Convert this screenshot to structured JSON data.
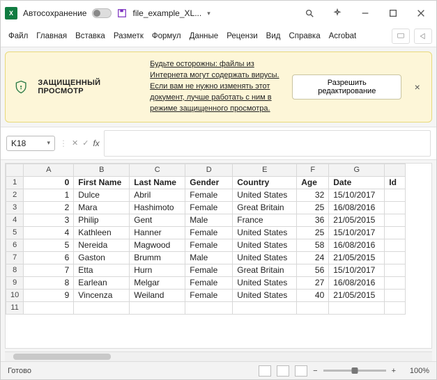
{
  "titlebar": {
    "autosave": "Автосохранение",
    "filename": "file_example_XL..."
  },
  "menu": {
    "items": [
      "Файл",
      "Главная",
      "Вставка",
      "Разметк",
      "Формул",
      "Данные",
      "Рецензи",
      "Вид",
      "Справка",
      "Acrobat"
    ]
  },
  "banner": {
    "title": "ЗАЩИЩЕННЫЙ ПРОСМОТР",
    "message": "Будьте осторожны: файлы из Интернета могут содержать вирусы. Если вам не нужно изменять этот документ, лучше работать с ним в режиме защищенного просмотра.",
    "action": "Разрешить редактирование"
  },
  "formula": {
    "cellref": "K18",
    "value": ""
  },
  "sheet": {
    "columns": [
      "A",
      "B",
      "C",
      "D",
      "E",
      "F",
      "G"
    ],
    "headers": [
      "0",
      "First Name",
      "Last Name",
      "Gender",
      "Country",
      "Age",
      "Date",
      "Id"
    ],
    "rows": [
      {
        "n": "1",
        "fn": "Dulce",
        "ln": "Abril",
        "g": "Female",
        "c": "United States",
        "a": "32",
        "d": "15/10/2017"
      },
      {
        "n": "2",
        "fn": "Mara",
        "ln": "Hashimoto",
        "g": "Female",
        "c": "Great Britain",
        "a": "25",
        "d": "16/08/2016"
      },
      {
        "n": "3",
        "fn": "Philip",
        "ln": "Gent",
        "g": "Male",
        "c": "France",
        "a": "36",
        "d": "21/05/2015"
      },
      {
        "n": "4",
        "fn": "Kathleen",
        "ln": "Hanner",
        "g": "Female",
        "c": "United States",
        "a": "25",
        "d": "15/10/2017"
      },
      {
        "n": "5",
        "fn": "Nereida",
        "ln": "Magwood",
        "g": "Female",
        "c": "United States",
        "a": "58",
        "d": "16/08/2016"
      },
      {
        "n": "6",
        "fn": "Gaston",
        "ln": "Brumm",
        "g": "Male",
        "c": "United States",
        "a": "24",
        "d": "21/05/2015"
      },
      {
        "n": "7",
        "fn": "Etta",
        "ln": "Hurn",
        "g": "Female",
        "c": "Great Britain",
        "a": "56",
        "d": "15/10/2017"
      },
      {
        "n": "8",
        "fn": "Earlean",
        "ln": "Melgar",
        "g": "Female",
        "c": "United States",
        "a": "27",
        "d": "16/08/2016"
      },
      {
        "n": "9",
        "fn": "Vincenza",
        "ln": "Weiland",
        "g": "Female",
        "c": "United States",
        "a": "40",
        "d": "21/05/2015"
      }
    ],
    "blank_row": "11"
  },
  "status": {
    "ready": "Готово",
    "zoom": "100%"
  }
}
